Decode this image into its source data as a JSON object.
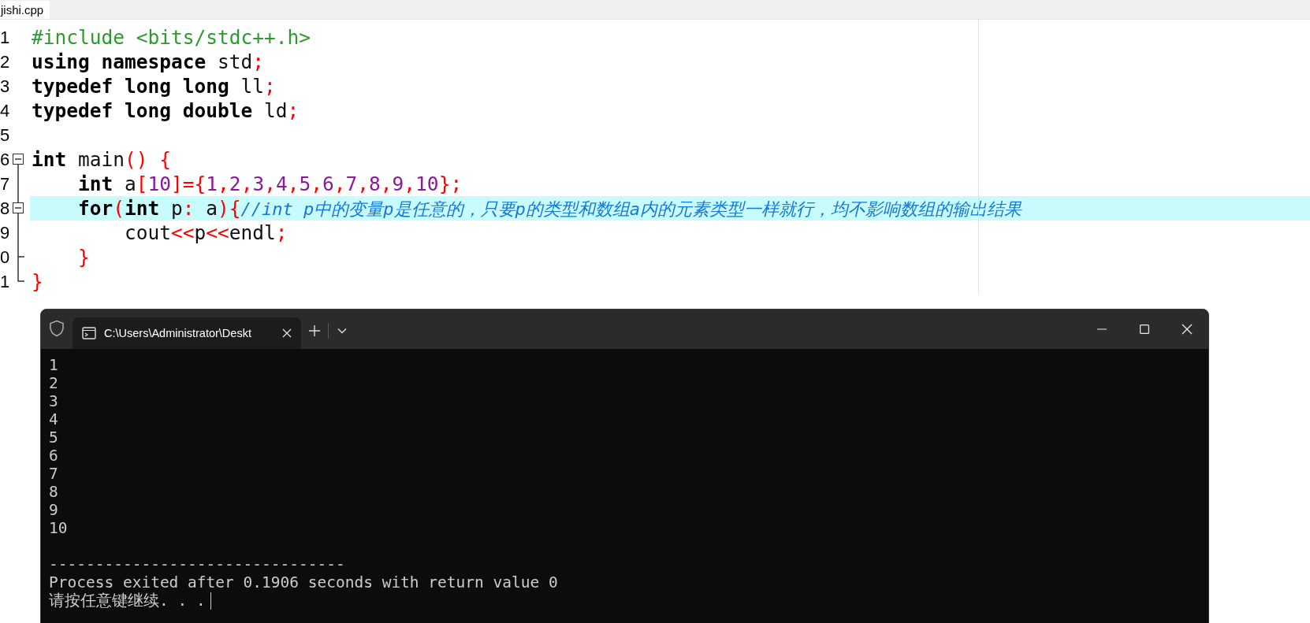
{
  "editor": {
    "tab": {
      "label": "jishi.cpp",
      "selected": true
    },
    "lines": [
      {
        "number": "1",
        "highlighted": false,
        "tokens": [
          {
            "kind": "preproc",
            "text": "#include <bits/stdc++.h>"
          }
        ]
      },
      {
        "number": "2",
        "highlighted": false,
        "tokens": [
          {
            "kind": "keyword",
            "text": "using namespace "
          },
          {
            "kind": "ident",
            "text": "std"
          },
          {
            "kind": "punct",
            "text": ";"
          }
        ]
      },
      {
        "number": "3",
        "highlighted": false,
        "tokens": [
          {
            "kind": "keyword",
            "text": "typedef long long "
          },
          {
            "kind": "ident",
            "text": "ll"
          },
          {
            "kind": "punct",
            "text": ";"
          }
        ]
      },
      {
        "number": "4",
        "highlighted": false,
        "tokens": [
          {
            "kind": "keyword",
            "text": "typedef long double "
          },
          {
            "kind": "ident",
            "text": "ld"
          },
          {
            "kind": "punct",
            "text": ";"
          }
        ]
      },
      {
        "number": "5",
        "highlighted": false
      },
      {
        "number": "6",
        "highlighted": false,
        "fold": {
          "kind": "open"
        },
        "tokens": [
          {
            "kind": "keyword",
            "text": "int "
          },
          {
            "kind": "ident",
            "text": "main"
          },
          {
            "kind": "punct",
            "text": "() {"
          }
        ]
      },
      {
        "number": "7",
        "highlighted": false,
        "fold": {
          "kind": "through"
        },
        "tokens": [
          {
            "kind": "keyword",
            "text": "    int "
          },
          {
            "kind": "ident",
            "text": "a"
          },
          {
            "kind": "punct",
            "text": "["
          },
          {
            "kind": "number",
            "text": "10"
          },
          {
            "kind": "punct",
            "text": "]={"
          },
          {
            "kind": "number",
            "text": "1"
          },
          {
            "kind": "punct",
            "text": ","
          },
          {
            "kind": "number",
            "text": "2"
          },
          {
            "kind": "punct",
            "text": ","
          },
          {
            "kind": "number",
            "text": "3"
          },
          {
            "kind": "punct",
            "text": ","
          },
          {
            "kind": "number",
            "text": "4"
          },
          {
            "kind": "punct",
            "text": ","
          },
          {
            "kind": "number",
            "text": "5"
          },
          {
            "kind": "punct",
            "text": ","
          },
          {
            "kind": "number",
            "text": "6"
          },
          {
            "kind": "punct",
            "text": ","
          },
          {
            "kind": "number",
            "text": "7"
          },
          {
            "kind": "punct",
            "text": ","
          },
          {
            "kind": "number",
            "text": "8"
          },
          {
            "kind": "punct",
            "text": ","
          },
          {
            "kind": "number",
            "text": "9"
          },
          {
            "kind": "punct",
            "text": ","
          },
          {
            "kind": "number",
            "text": "10"
          },
          {
            "kind": "punct",
            "text": "};"
          }
        ]
      },
      {
        "number": "8",
        "highlighted": true,
        "fold": {
          "kind": "open-inner"
        },
        "tokens": [
          {
            "kind": "keyword",
            "text": "    for"
          },
          {
            "kind": "punct",
            "text": "("
          },
          {
            "kind": "keyword",
            "text": "int "
          },
          {
            "kind": "ident",
            "text": "p"
          },
          {
            "kind": "punct",
            "text": ":"
          },
          {
            "kind": "ident",
            "text": " a"
          },
          {
            "kind": "punct",
            "text": "){"
          },
          {
            "kind": "comment",
            "text": "//int p中的变量p是任意的，只要p的类型和数组a内的元素类型一样就行，均不影响数组的输出结果"
          }
        ]
      },
      {
        "number": "9",
        "highlighted": false,
        "fold": {
          "kind": "through"
        },
        "tokens": [
          {
            "kind": "ident",
            "text": "        cout"
          },
          {
            "kind": "punct",
            "text": "<<"
          },
          {
            "kind": "ident",
            "text": "p"
          },
          {
            "kind": "punct",
            "text": "<<"
          },
          {
            "kind": "ident",
            "text": "endl"
          },
          {
            "kind": "punct",
            "text": ";"
          }
        ]
      },
      {
        "number": "0",
        "highlighted": false,
        "fold": {
          "kind": "branch-end"
        },
        "tokens": [
          {
            "kind": "punct",
            "text": "    }"
          }
        ]
      },
      {
        "number": "1",
        "highlighted": false,
        "fold": {
          "kind": "end"
        },
        "tokens": [
          {
            "kind": "punct",
            "text": "}"
          }
        ]
      }
    ]
  },
  "terminal": {
    "tab": {
      "title": "C:\\Users\\Administrator\\Deskt",
      "selected": true
    },
    "output": [
      "1",
      "2",
      "3",
      "4",
      "5",
      "6",
      "7",
      "8",
      "9",
      "10"
    ],
    "separator": "--------------------------------",
    "status": "Process exited after 0.1906 seconds with return value 0",
    "prompt": "请按任意键继续. . ."
  }
}
